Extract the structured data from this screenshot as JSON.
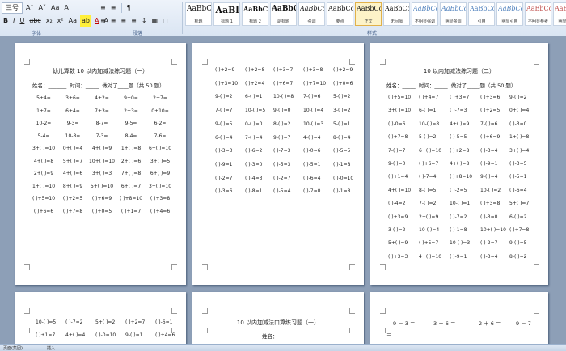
{
  "ribbon": {
    "font_size": "三号",
    "row1_left": [
      "A˄",
      "A˅",
      "Aa",
      "A"
    ],
    "row1_right": [
      "≡",
      "≡",
      "¶"
    ],
    "row2_left": [
      "B",
      "I",
      "U",
      "abc",
      "x₂",
      "x²",
      "Aa",
      "ab",
      "A",
      "A"
    ],
    "row2_right": [
      "≡",
      "≡",
      "≡",
      "≡",
      "↕",
      "▦",
      "◻"
    ],
    "groups": {
      "font": "字体",
      "paragraph": "段落",
      "styles": "样式"
    },
    "styles": [
      {
        "sample": "AaBbC",
        "name": "标题"
      },
      {
        "sample": "AaBl",
        "name": "标题 1"
      },
      {
        "sample": "AaBbCc",
        "name": "标题 2"
      },
      {
        "sample": "AaBbC",
        "name": "副标题"
      },
      {
        "sample": "AaBbCcD",
        "name": "强调"
      },
      {
        "sample": "AaBbCcD",
        "name": "要点"
      },
      {
        "sample": "AaBbCcD",
        "name": "正文"
      },
      {
        "sample": "AaBbCcD",
        "name": "无间隔"
      },
      {
        "sample": "AaBbCcD",
        "name": "不明显强调"
      },
      {
        "sample": "AaBbCcD",
        "name": "明显强调"
      },
      {
        "sample": "AaBbCcD",
        "name": "引用"
      },
      {
        "sample": "AaBbCcD",
        "name": "明显引用"
      },
      {
        "sample": "AaBbCcD",
        "name": "不明显参考"
      },
      {
        "sample": "AaBbCcI",
        "name": "明显参考"
      }
    ]
  },
  "pages": {
    "p1": {
      "title": "幼儿算数 10 以内加减法练习题（一）",
      "info": "姓名：_______  时间：_____  做对了____题（共 50 题）",
      "rows": [
        [
          "5+4=",
          "3+6=",
          "4+2=",
          "9+0=",
          "2+7="
        ],
        [
          "1+7=",
          "6+4=",
          "7+3=",
          "2+3=",
          "0+10="
        ],
        [
          "10-2=",
          "9-3=",
          "8-7=",
          "9-5=",
          "6-2="
        ],
        [
          "5-4=",
          "10-8=",
          "7-3=",
          "8-4=",
          "7-6="
        ],
        [
          "3+(  )=10",
          "0+(  )=4",
          "4+(  )=9",
          "1+(  )=8",
          "6+(  )=10"
        ],
        [
          "4+(  )=8",
          "5+(  )=7",
          "10+(  )=10",
          "2+(  )=6",
          "3+(  )=5"
        ],
        [
          "2+(  )=9",
          "4+(  )=6",
          "3+(  )=3",
          "7+(  )=8",
          "6+(  )=9"
        ],
        [
          "1+(  )=10",
          "8+(  )=9",
          "5+(  )=10",
          "6+(  )=7",
          "3+(  )=10"
        ],
        [
          "(  )+5=10",
          "(  )+2=5",
          "(  )+6=9",
          "(  )+8=10",
          "(  )+3=8"
        ],
        [
          "(  )+6=6",
          "(  )+7=8",
          "(  )+0=5",
          "(  )+1=7",
          "(  )+4=6"
        ]
      ]
    },
    "p2": {
      "rows": [
        [
          "(  )+2=9",
          "(  )+2=8",
          "(  )+3=7",
          "(  )+3=8",
          "(  )+2=9"
        ],
        [
          "(  )+3=10",
          "(  )+2=4",
          "(  )+6=7",
          "(  )+7=10",
          "(  )+0=6"
        ],
        [
          "9-(  )=2",
          "6-(  )=1",
          "10-(  )=8",
          "7-(  )=6",
          "5-(  )=2"
        ],
        [
          "7-(  )=7",
          "10-(  )=5",
          "9-(  )=0",
          "10-(  )=4",
          "3-(  )=2"
        ],
        [
          "9-(  )=5",
          "0-(  )=0",
          "8-(  )=2",
          "10-(  )=3",
          "5-(  )=1"
        ],
        [
          "6-(  )=4",
          "7-(  )=4",
          "9-(  )=7",
          "4-(  )=4",
          "8-(  )=4"
        ],
        [
          "(  )-3=3",
          "(  )-6=2",
          "(  )-7=3",
          "(  )-0=6",
          "(  )-5=5"
        ],
        [
          "(  )-9=1",
          "(  )-3=0",
          "(  )-5=3",
          "(  )-5=1",
          "(  )-1=8"
        ],
        [
          "(  )-2=7",
          "(  )-4=3",
          "(  )-2=7",
          "(  )-6=4",
          "(  )-0=10"
        ],
        [
          "(  )-3=6",
          "(  )-8=1",
          "(  )-5=4",
          "(  )-7=0",
          "(  )-1=8"
        ]
      ]
    },
    "p3": {
      "title": "10 以内加减法练习题（二）",
      "info": "姓名：_____  时间：_____  做对了_____题（共 50 题）",
      "rows": [
        [
          "(  )+5=10",
          "(  )+4=7",
          "(  )+3=7",
          "(  )+3=6",
          "9-(  )=2"
        ],
        [
          "3+(  )=10",
          "6-(  )=1",
          "(  )-7=3",
          "(  )+2=5",
          "0+(  )=4"
        ],
        [
          "(  )-0=6",
          "10-(  )=8",
          "4+(  )=9",
          "7-(  )=6",
          "(  )-3=0"
        ],
        [
          "(  )+7=8",
          "5-(  )=2",
          "(  )-5=5",
          "(  )+6=9",
          "1+(  )=8"
        ],
        [
          "7-(  )=7",
          "6+(  )=10",
          "(  )+2=8",
          "(  )-3=4",
          "3+(  )=4"
        ],
        [
          "9-(  )=0",
          "(  )+6=7",
          "4+(  )=8",
          "(  )-9=1",
          "(  )-3=5"
        ],
        [
          "(  )+1=4",
          "(  )-7=4",
          "(  )+8=10",
          "9-(  )=4",
          "(  )-5=1"
        ],
        [
          "4+(  )=10",
          "8-(  )=5",
          "(  )-2=5",
          "10-(  )=2",
          "(  )-6=4"
        ],
        [
          "(  )-4=2",
          "7-(  )=2",
          "10-(  )=1",
          "(  )+3=8",
          "5+(  )=7"
        ],
        [
          "(  )+3=9",
          "2+(  )=9",
          "(  )-7=2",
          "(  )-3=0",
          "6-(  )=2"
        ],
        [
          "3-(  )=2",
          "10-(  )=4",
          "(  )-1=8",
          "10+(  )=10",
          "(  )+7=8"
        ],
        [
          "5+(  )=9",
          "(  )+5=7",
          "10-(  )=3",
          "(  )-2=7",
          "9-(  )=5"
        ],
        [
          "(  )+3=3",
          "4+(  )=10",
          "(  )-9=1",
          "(  )-3=4",
          "8-(  )=2"
        ]
      ]
    },
    "p4": {
      "rows": [
        [
          "10-(  )=5",
          "(  )-7=2",
          "5+(  )=2",
          "(  )+2=7",
          "(  )-6=1"
        ],
        [
          "(  )+1=7",
          "4+(  )=4",
          "(  )-0=10",
          "9-(  )=1",
          "(  )+4=6"
        ]
      ]
    },
    "p5": {
      "title": "10 以内加减法口算练习题（一）",
      "info": "姓名："
    },
    "p6": {
      "row": [
        "9 － 3 ＝",
        "3 ＋ 6 ＝",
        "2 ＋ 6 ＝",
        "9 － 7"
      ],
      "tail": "＝"
    }
  },
  "status": {
    "left": "页面(集团)",
    "mode": "插入"
  }
}
